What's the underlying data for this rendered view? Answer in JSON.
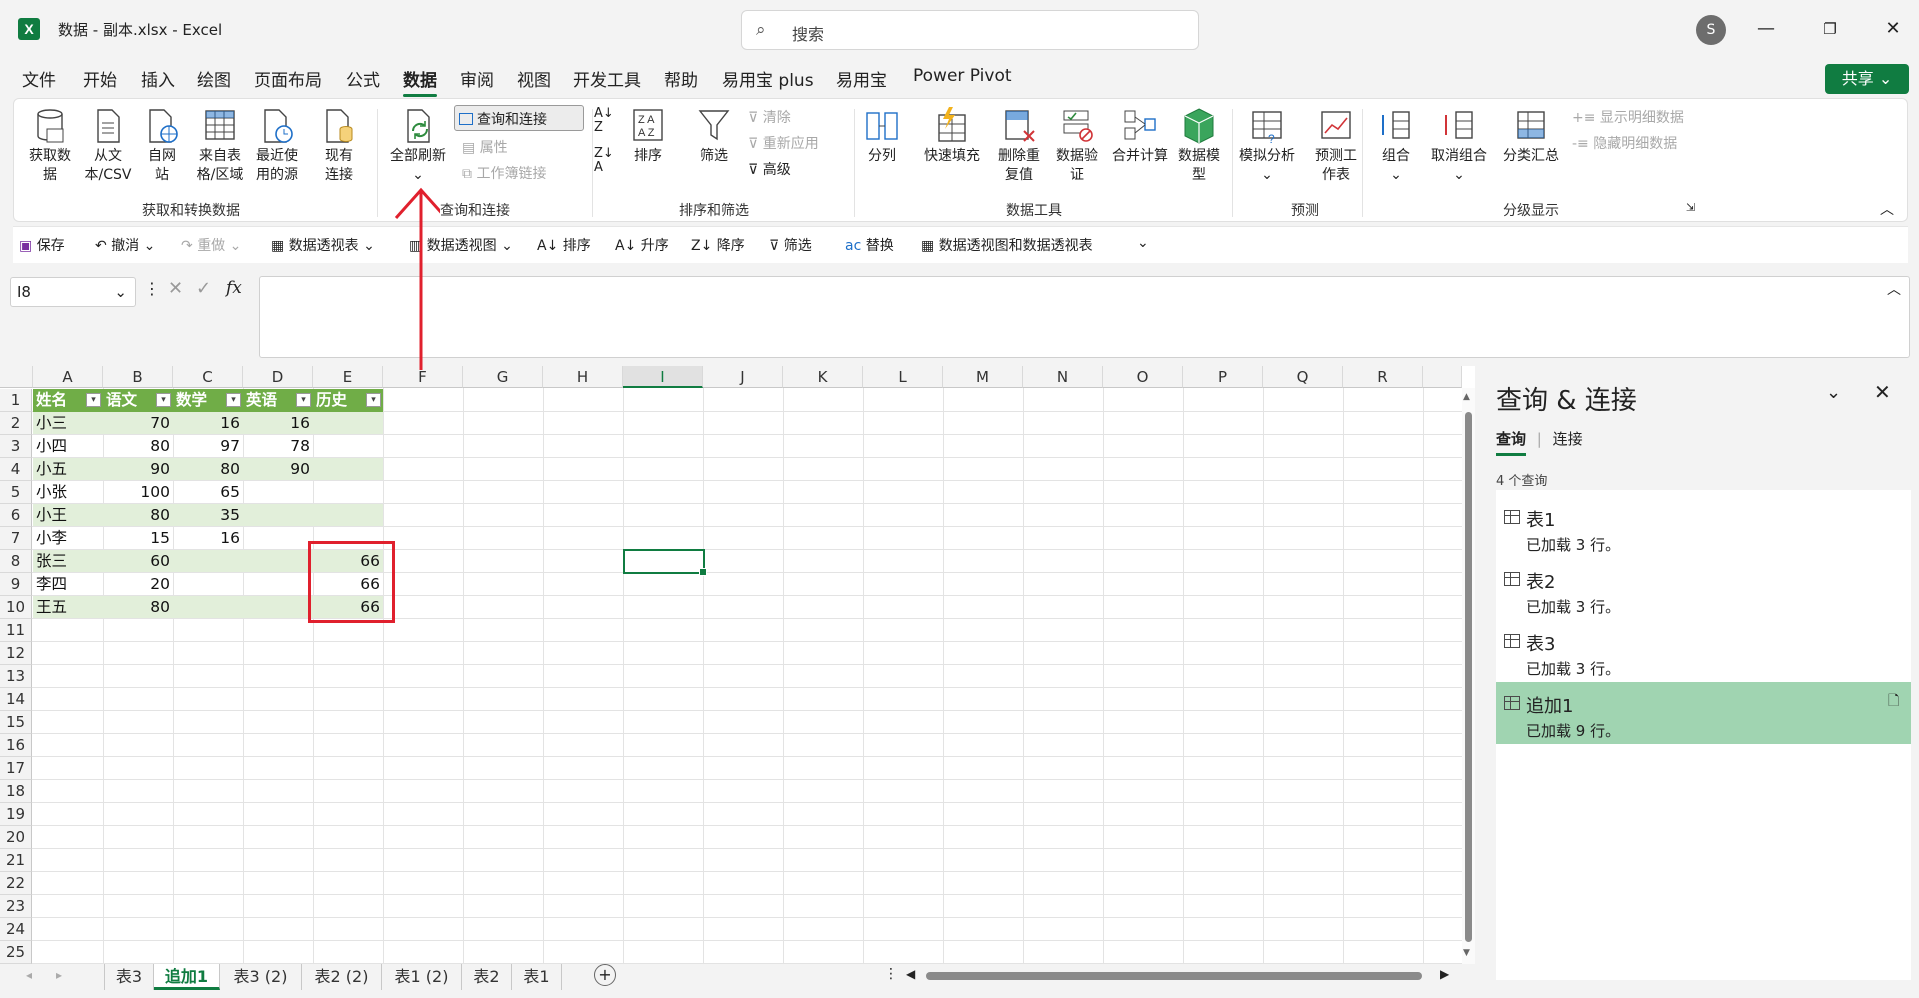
{
  "titlebar": {
    "app_title": "数据 - 副本.xlsx  -  Excel",
    "search_placeholder": "搜索",
    "avatar": "S",
    "logo": "X"
  },
  "menu": [
    "文件",
    "开始",
    "插入",
    "绘图",
    "页面布局",
    "公式",
    "数据",
    "审阅",
    "视图",
    "开发工具",
    "帮助",
    "易用宝 plus",
    "易用宝",
    "Power Pivot"
  ],
  "share_label": "共享",
  "ribbon": {
    "get_data": "获取数据",
    "from_text_csv": "从文本/CSV",
    "from_web": "自网站",
    "from_table": "来自表格/区域",
    "recent_sources": "最近使用的源",
    "existing_conn": "现有连接",
    "group_get": "获取和转换数据",
    "refresh_all": "全部刷新",
    "queries_conn": "查询和连接",
    "properties": "属性",
    "workbook_links": "工作簿链接",
    "group_queries": "查询和连接",
    "sort": "排序",
    "filter": "筛选",
    "clear": "清除",
    "reapply": "重新应用",
    "advanced": "高级",
    "group_sort": "排序和筛选",
    "text_to_cols": "分列",
    "flash_fill": "快速填充",
    "remove_dup": "删除重复值",
    "data_valid": "数据验证",
    "consolidate": "合并计算",
    "data_model": "数据模型",
    "group_tools": "数据工具",
    "what_if": "模拟分析",
    "forecast": "预测工作表",
    "group_forecast": "预测",
    "group": "组合",
    "ungroup": "取消组合",
    "subtotal": "分类汇总",
    "show_detail": "显示明细数据",
    "hide_detail": "隐藏明细数据",
    "group_outline": "分级显示"
  },
  "qat": {
    "save": "保存",
    "undo": "撤消",
    "redo": "重做",
    "pivot": "数据透视表",
    "pivot_chart": "数据透视图",
    "sort": "排序",
    "asc": "升序",
    "desc": "降序",
    "filter": "筛选",
    "replace": "替换",
    "pivot_both": "数据透视图和数据透视表"
  },
  "formula": {
    "name_box": "I8",
    "fx": "fx",
    "value": ""
  },
  "columns": [
    "A",
    "B",
    "C",
    "D",
    "E",
    "F",
    "G",
    "H",
    "I",
    "J",
    "K",
    "L",
    "M",
    "N",
    "O",
    "P",
    "Q",
    "R"
  ],
  "rows": [
    "1",
    "2",
    "3",
    "4",
    "5",
    "6",
    "7",
    "8",
    "9",
    "10",
    "11",
    "12",
    "13",
    "14",
    "15",
    "16",
    "17",
    "18",
    "19",
    "20",
    "21",
    "22",
    "23",
    "24",
    "25"
  ],
  "table": {
    "headers": [
      "姓名",
      "语文",
      "数学",
      "英语",
      "历史"
    ],
    "data": [
      [
        "小三",
        "70",
        "16",
        "16",
        ""
      ],
      [
        "小四",
        "80",
        "97",
        "78",
        ""
      ],
      [
        "小五",
        "90",
        "80",
        "90",
        ""
      ],
      [
        "小张",
        "100",
        "65",
        "",
        ""
      ],
      [
        "小王",
        "80",
        "35",
        "",
        ""
      ],
      [
        "小李",
        "15",
        "16",
        "",
        ""
      ],
      [
        "张三",
        "60",
        "",
        "",
        "66"
      ],
      [
        "李四",
        "20",
        "",
        "",
        "66"
      ],
      [
        "王五",
        "80",
        "",
        "",
        "66"
      ]
    ]
  },
  "sheet_tabs": [
    "表3",
    "追加1",
    "表3 (2)",
    "表2 (2)",
    "表1 (2)",
    "表2",
    "表1"
  ],
  "active_tab": "追加1",
  "pane": {
    "title": "查询 & 连接",
    "tab_queries": "查询",
    "tab_connections": "连接",
    "count": "4 个查询",
    "queries": [
      {
        "name": "表1",
        "status": "已加载 3 行。"
      },
      {
        "name": "表2",
        "status": "已加载 3 行。"
      },
      {
        "name": "表3",
        "status": "已加载 3 行。"
      },
      {
        "name": "追加1",
        "status": "已加载 9 行。"
      }
    ]
  }
}
